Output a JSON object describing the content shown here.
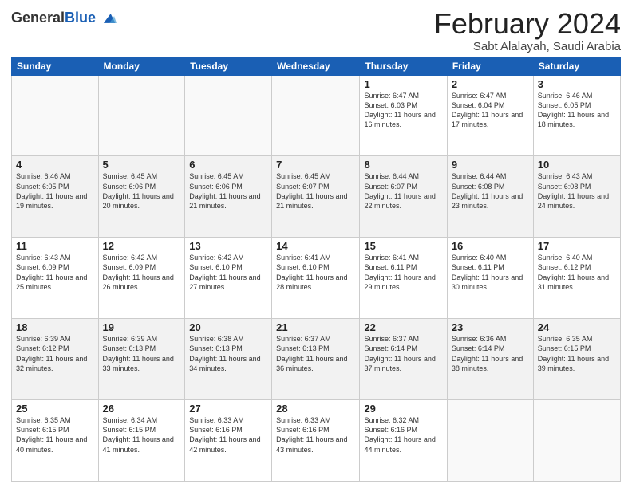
{
  "logo": {
    "general": "General",
    "blue": "Blue"
  },
  "header": {
    "month_year": "February 2024",
    "location": "Sabt Alalayah, Saudi Arabia"
  },
  "days_of_week": [
    "Sunday",
    "Monday",
    "Tuesday",
    "Wednesday",
    "Thursday",
    "Friday",
    "Saturday"
  ],
  "weeks": [
    {
      "shaded": false,
      "days": [
        {
          "num": "",
          "info": ""
        },
        {
          "num": "",
          "info": ""
        },
        {
          "num": "",
          "info": ""
        },
        {
          "num": "",
          "info": ""
        },
        {
          "num": "1",
          "info": "Sunrise: 6:47 AM\nSunset: 6:03 PM\nDaylight: 11 hours\nand 16 minutes."
        },
        {
          "num": "2",
          "info": "Sunrise: 6:47 AM\nSunset: 6:04 PM\nDaylight: 11 hours\nand 17 minutes."
        },
        {
          "num": "3",
          "info": "Sunrise: 6:46 AM\nSunset: 6:05 PM\nDaylight: 11 hours\nand 18 minutes."
        }
      ]
    },
    {
      "shaded": true,
      "days": [
        {
          "num": "4",
          "info": "Sunrise: 6:46 AM\nSunset: 6:05 PM\nDaylight: 11 hours\nand 19 minutes."
        },
        {
          "num": "5",
          "info": "Sunrise: 6:45 AM\nSunset: 6:06 PM\nDaylight: 11 hours\nand 20 minutes."
        },
        {
          "num": "6",
          "info": "Sunrise: 6:45 AM\nSunset: 6:06 PM\nDaylight: 11 hours\nand 21 minutes."
        },
        {
          "num": "7",
          "info": "Sunrise: 6:45 AM\nSunset: 6:07 PM\nDaylight: 11 hours\nand 21 minutes."
        },
        {
          "num": "8",
          "info": "Sunrise: 6:44 AM\nSunset: 6:07 PM\nDaylight: 11 hours\nand 22 minutes."
        },
        {
          "num": "9",
          "info": "Sunrise: 6:44 AM\nSunset: 6:08 PM\nDaylight: 11 hours\nand 23 minutes."
        },
        {
          "num": "10",
          "info": "Sunrise: 6:43 AM\nSunset: 6:08 PM\nDaylight: 11 hours\nand 24 minutes."
        }
      ]
    },
    {
      "shaded": false,
      "days": [
        {
          "num": "11",
          "info": "Sunrise: 6:43 AM\nSunset: 6:09 PM\nDaylight: 11 hours\nand 25 minutes."
        },
        {
          "num": "12",
          "info": "Sunrise: 6:42 AM\nSunset: 6:09 PM\nDaylight: 11 hours\nand 26 minutes."
        },
        {
          "num": "13",
          "info": "Sunrise: 6:42 AM\nSunset: 6:10 PM\nDaylight: 11 hours\nand 27 minutes."
        },
        {
          "num": "14",
          "info": "Sunrise: 6:41 AM\nSunset: 6:10 PM\nDaylight: 11 hours\nand 28 minutes."
        },
        {
          "num": "15",
          "info": "Sunrise: 6:41 AM\nSunset: 6:11 PM\nDaylight: 11 hours\nand 29 minutes."
        },
        {
          "num": "16",
          "info": "Sunrise: 6:40 AM\nSunset: 6:11 PM\nDaylight: 11 hours\nand 30 minutes."
        },
        {
          "num": "17",
          "info": "Sunrise: 6:40 AM\nSunset: 6:12 PM\nDaylight: 11 hours\nand 31 minutes."
        }
      ]
    },
    {
      "shaded": true,
      "days": [
        {
          "num": "18",
          "info": "Sunrise: 6:39 AM\nSunset: 6:12 PM\nDaylight: 11 hours\nand 32 minutes."
        },
        {
          "num": "19",
          "info": "Sunrise: 6:39 AM\nSunset: 6:13 PM\nDaylight: 11 hours\nand 33 minutes."
        },
        {
          "num": "20",
          "info": "Sunrise: 6:38 AM\nSunset: 6:13 PM\nDaylight: 11 hours\nand 34 minutes."
        },
        {
          "num": "21",
          "info": "Sunrise: 6:37 AM\nSunset: 6:13 PM\nDaylight: 11 hours\nand 36 minutes."
        },
        {
          "num": "22",
          "info": "Sunrise: 6:37 AM\nSunset: 6:14 PM\nDaylight: 11 hours\nand 37 minutes."
        },
        {
          "num": "23",
          "info": "Sunrise: 6:36 AM\nSunset: 6:14 PM\nDaylight: 11 hours\nand 38 minutes."
        },
        {
          "num": "24",
          "info": "Sunrise: 6:35 AM\nSunset: 6:15 PM\nDaylight: 11 hours\nand 39 minutes."
        }
      ]
    },
    {
      "shaded": false,
      "days": [
        {
          "num": "25",
          "info": "Sunrise: 6:35 AM\nSunset: 6:15 PM\nDaylight: 11 hours\nand 40 minutes."
        },
        {
          "num": "26",
          "info": "Sunrise: 6:34 AM\nSunset: 6:15 PM\nDaylight: 11 hours\nand 41 minutes."
        },
        {
          "num": "27",
          "info": "Sunrise: 6:33 AM\nSunset: 6:16 PM\nDaylight: 11 hours\nand 42 minutes."
        },
        {
          "num": "28",
          "info": "Sunrise: 6:33 AM\nSunset: 6:16 PM\nDaylight: 11 hours\nand 43 minutes."
        },
        {
          "num": "29",
          "info": "Sunrise: 6:32 AM\nSunset: 6:16 PM\nDaylight: 11 hours\nand 44 minutes."
        },
        {
          "num": "",
          "info": ""
        },
        {
          "num": "",
          "info": ""
        }
      ]
    }
  ]
}
